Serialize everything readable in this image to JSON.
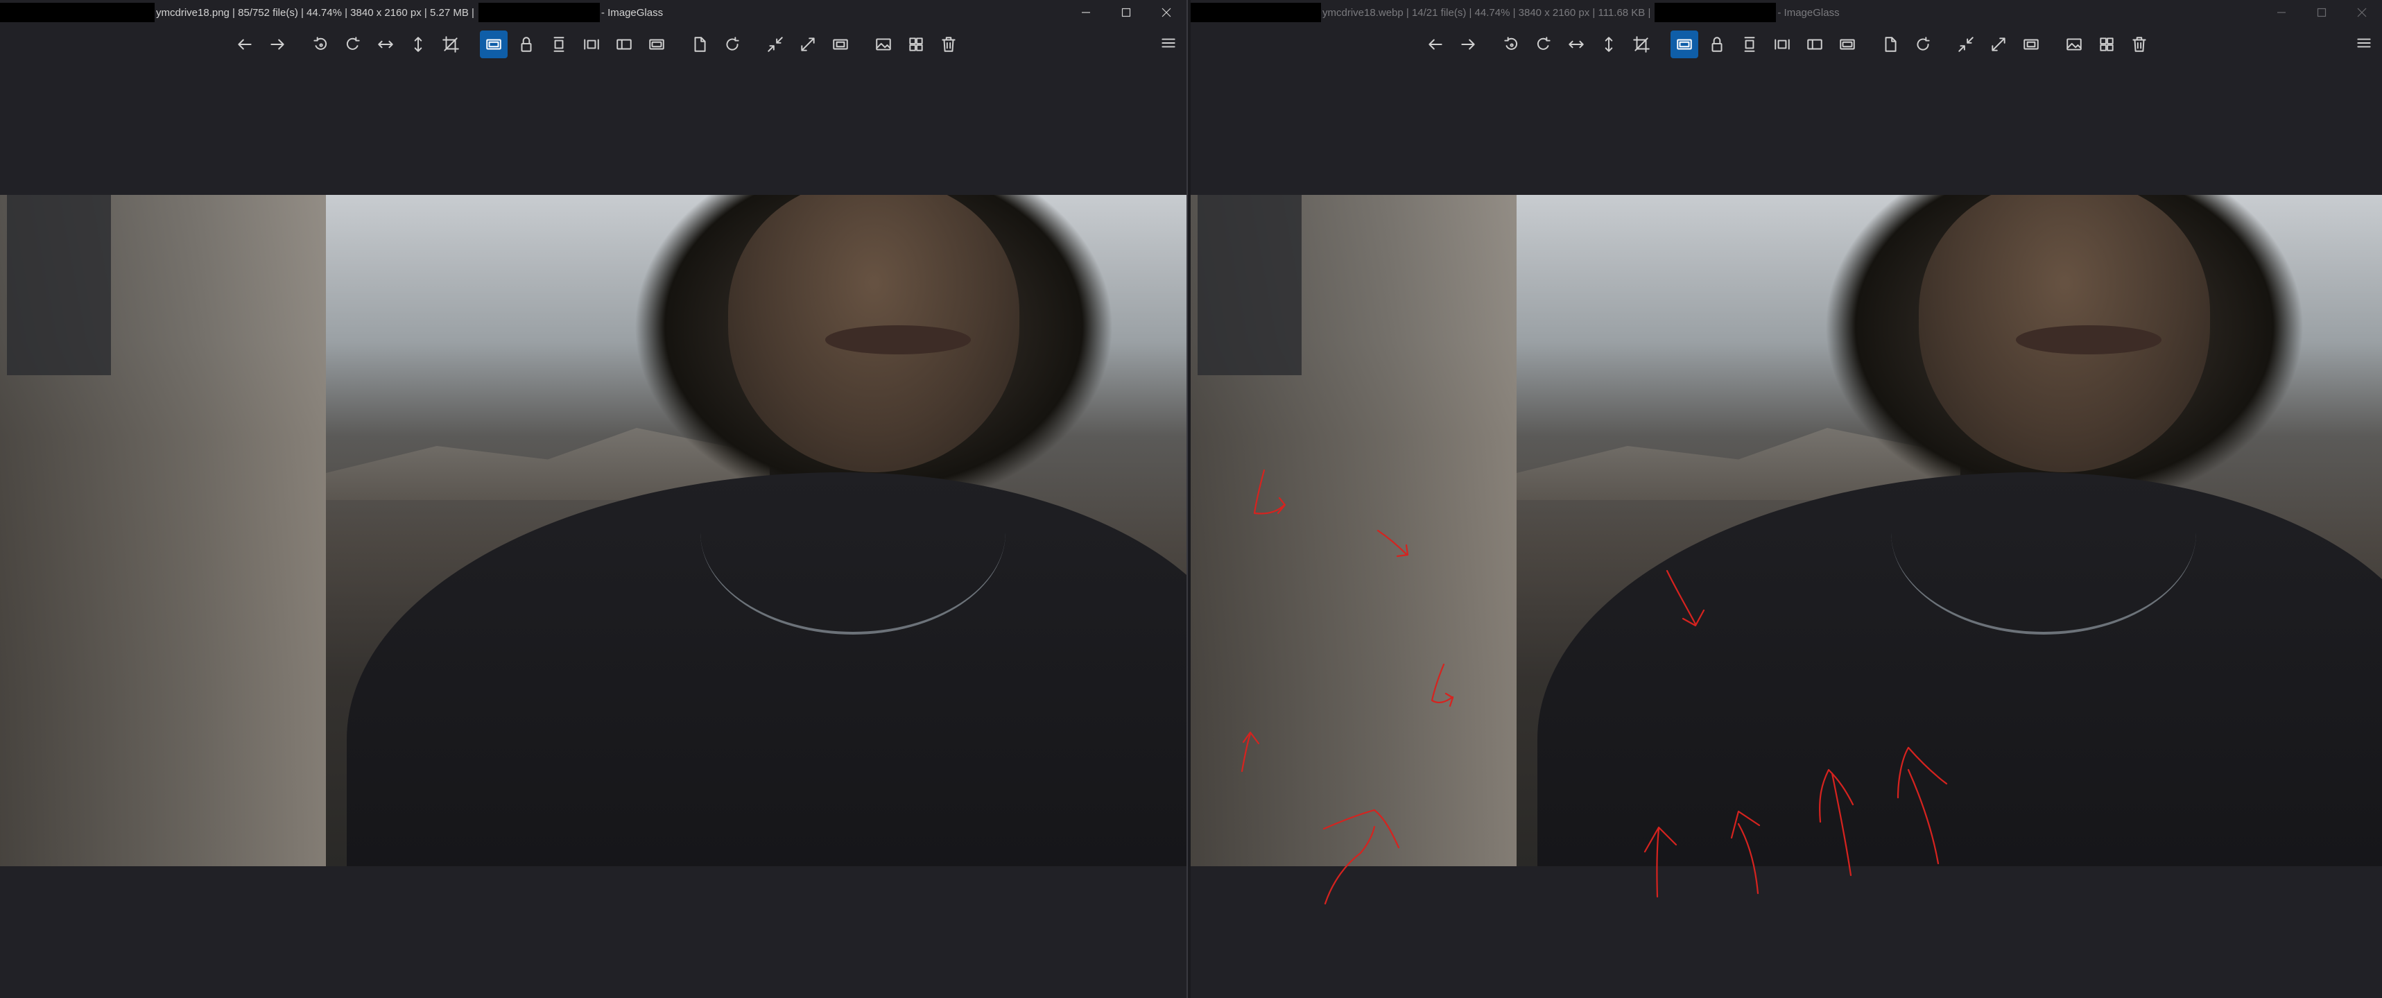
{
  "left_window": {
    "filename": "ymcdrive18.png",
    "title": "ymcdrive18.png  |  85/752 file(s)  |  44.74%  |  3840 x 2160 px  |  5.27 MB  |",
    "app_suffix": "- ImageGlass",
    "active": true
  },
  "right_window": {
    "filename": "ymcdrive18.webp",
    "title": "ymcdrive18.webp  |  14/21 file(s)  |  44.74%  |  3840 x 2160 px  |  111.68 KB  |",
    "app_suffix": "- ImageGlass",
    "active": false
  },
  "window_controls": [
    "minimize-icon",
    "maximize-icon",
    "close-icon"
  ],
  "toolbar": [
    "back-arrow-icon",
    "forward-arrow-icon",
    "rotate-left-icon",
    "rotate-right-icon",
    "flip-horizontal-icon",
    "flip-vertical-icon",
    "crop-icon",
    "auto-zoom-icon",
    "lock-zoom-icon",
    "fit-height-icon",
    "fit-width-icon",
    "scale-to-fit-icon",
    "scale-to-fill-icon",
    "open-file-icon",
    "refresh-icon",
    "zoom-out-icon",
    "fullscreen-icon",
    "slideshow-icon",
    "image-icon",
    "gallery-icon",
    "delete-icon"
  ],
  "active_tool": "auto-zoom-icon",
  "colors": {
    "background": "#212126",
    "active_button": "#0f5ea8",
    "annotation_red": "#d6231f"
  }
}
